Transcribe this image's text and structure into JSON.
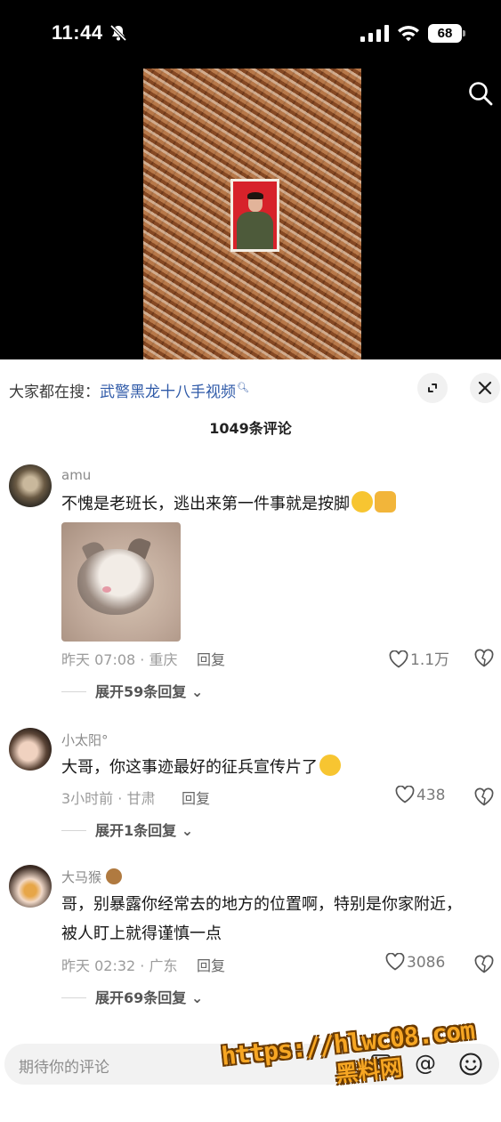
{
  "status_bar": {
    "time": "11:44",
    "battery": "68"
  },
  "hot_search": {
    "prefix": "大家都在搜：",
    "query": "武警黑龙十八手视频"
  },
  "comment_count": "1049条评论",
  "comments": [
    {
      "username": "amu",
      "text": "不愧是老班长，逃出来第一件事就是按脚",
      "meta": "昨天 07:08 · 重庆",
      "reply_label": "回复",
      "likes": "1.1万",
      "expand_label": "展开59条回复",
      "has_image": true
    },
    {
      "username": "小太阳°",
      "text": "大哥，你这事迹最好的征兵宣传片了",
      "meta": "3小时前 · 甘肃",
      "reply_label": "回复",
      "likes": "438",
      "expand_label": "展开1条回复"
    },
    {
      "username": "大马猴",
      "text": "哥，别暴露你经常去的地方的位置啊，特别是你家附近，被人盯上就得谨慎一点",
      "meta": "昨天 02:32 · 广东",
      "reply_label": "回复",
      "likes": "3086",
      "expand_label": "展开69条回复"
    }
  ],
  "input": {
    "placeholder": "期待你的评论"
  },
  "watermark": {
    "url": "https://hlwc08.com",
    "name": "黑料网"
  },
  "colors": {
    "link": "#2f5aa8",
    "watermark": "#f6a623"
  },
  "icons": [
    "bell-slash-icon",
    "signal-icon",
    "wifi-icon",
    "search-icon",
    "expand-icon",
    "close-icon",
    "heart-icon",
    "broken-heart-icon",
    "image-icon",
    "at-icon",
    "smile-icon"
  ]
}
